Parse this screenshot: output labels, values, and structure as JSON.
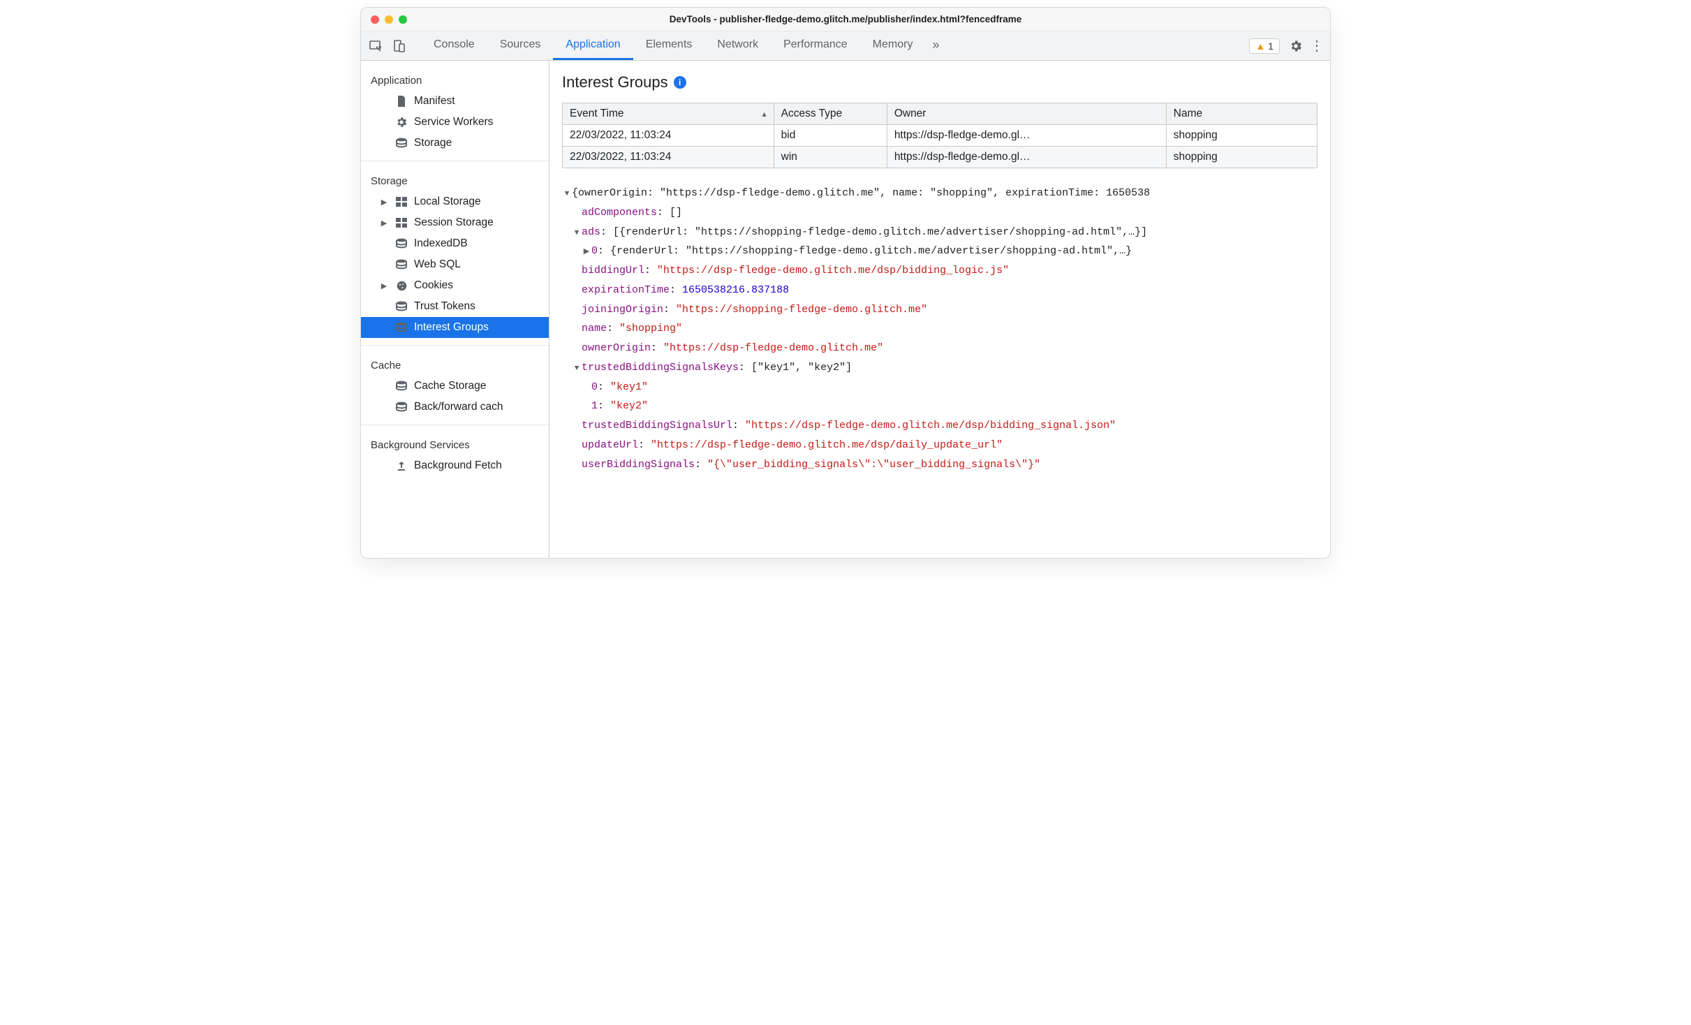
{
  "window": {
    "title": "DevTools - publisher-fledge-demo.glitch.me/publisher/index.html?fencedframe"
  },
  "tabs": {
    "items": [
      "Console",
      "Sources",
      "Application",
      "Elements",
      "Network",
      "Performance",
      "Memory"
    ],
    "active_index": 2,
    "overflow_glyph": "»",
    "warning_count": "1"
  },
  "sidebar": {
    "sections": [
      {
        "title": "Application",
        "items": [
          {
            "icon": "file",
            "label": "Manifest",
            "expandable": false
          },
          {
            "icon": "gear",
            "label": "Service Workers",
            "expandable": false
          },
          {
            "icon": "db",
            "label": "Storage",
            "expandable": false
          }
        ]
      },
      {
        "title": "Storage",
        "items": [
          {
            "icon": "grid",
            "label": "Local Storage",
            "expandable": true
          },
          {
            "icon": "grid",
            "label": "Session Storage",
            "expandable": true
          },
          {
            "icon": "db",
            "label": "IndexedDB",
            "expandable": false
          },
          {
            "icon": "db",
            "label": "Web SQL",
            "expandable": false
          },
          {
            "icon": "cookie",
            "label": "Cookies",
            "expandable": true
          },
          {
            "icon": "db",
            "label": "Trust Tokens",
            "expandable": false
          },
          {
            "icon": "db",
            "label": "Interest Groups",
            "expandable": false,
            "selected": true
          }
        ]
      },
      {
        "title": "Cache",
        "items": [
          {
            "icon": "db",
            "label": "Cache Storage",
            "expandable": false
          },
          {
            "icon": "db",
            "label": "Back/forward cach",
            "expandable": false
          }
        ]
      },
      {
        "title": "Background Services",
        "items": [
          {
            "icon": "upload",
            "label": "Background Fetch",
            "expandable": false
          }
        ]
      }
    ]
  },
  "panel": {
    "title": "Interest Groups",
    "columns": [
      "Event Time",
      "Access Type",
      "Owner",
      "Name"
    ],
    "col_widths": [
      "28%",
      "15%",
      "37%",
      "20%"
    ],
    "rows": [
      {
        "time": "22/03/2022, 11:03:24",
        "type": "bid",
        "owner": "https://dsp-fledge-demo.gl…",
        "name": "shopping"
      },
      {
        "time": "22/03/2022, 11:03:24",
        "type": "win",
        "owner": "https://dsp-fledge-demo.gl…",
        "name": "shopping"
      }
    ]
  },
  "details": {
    "summary": "{ownerOrigin: \"https://dsp-fledge-demo.glitch.me\", name: \"shopping\", expirationTime: 1650538",
    "adComponents": "[]",
    "ads_summary": "[{renderUrl: \"https://shopping-fledge-demo.glitch.me/advertiser/shopping-ad.html\",…}]",
    "ads_0": "{renderUrl: \"https://shopping-fledge-demo.glitch.me/advertiser/shopping-ad.html\",…}",
    "biddingUrl": "\"https://dsp-fledge-demo.glitch.me/dsp/bidding_logic.js\"",
    "expirationTime": "1650538216.837188",
    "joiningOrigin": "\"https://shopping-fledge-demo.glitch.me\"",
    "name": "\"shopping\"",
    "ownerOrigin": "\"https://dsp-fledge-demo.glitch.me\"",
    "tbsk_summary": "[\"key1\", \"key2\"]",
    "tbsk_0": "\"key1\"",
    "tbsk_1": "\"key2\"",
    "trustedBiddingSignalsUrl": "\"https://dsp-fledge-demo.glitch.me/dsp/bidding_signal.json\"",
    "updateUrl": "\"https://dsp-fledge-demo.glitch.me/dsp/daily_update_url\"",
    "userBiddingSignals": "\"{\\\"user_bidding_signals\\\":\\\"user_bidding_signals\\\"}\""
  },
  "icons": {
    "file": "▮",
    "gear": "⚙",
    "db": "≣",
    "grid": "▦",
    "cookie": "◑",
    "upload": "⬆"
  }
}
